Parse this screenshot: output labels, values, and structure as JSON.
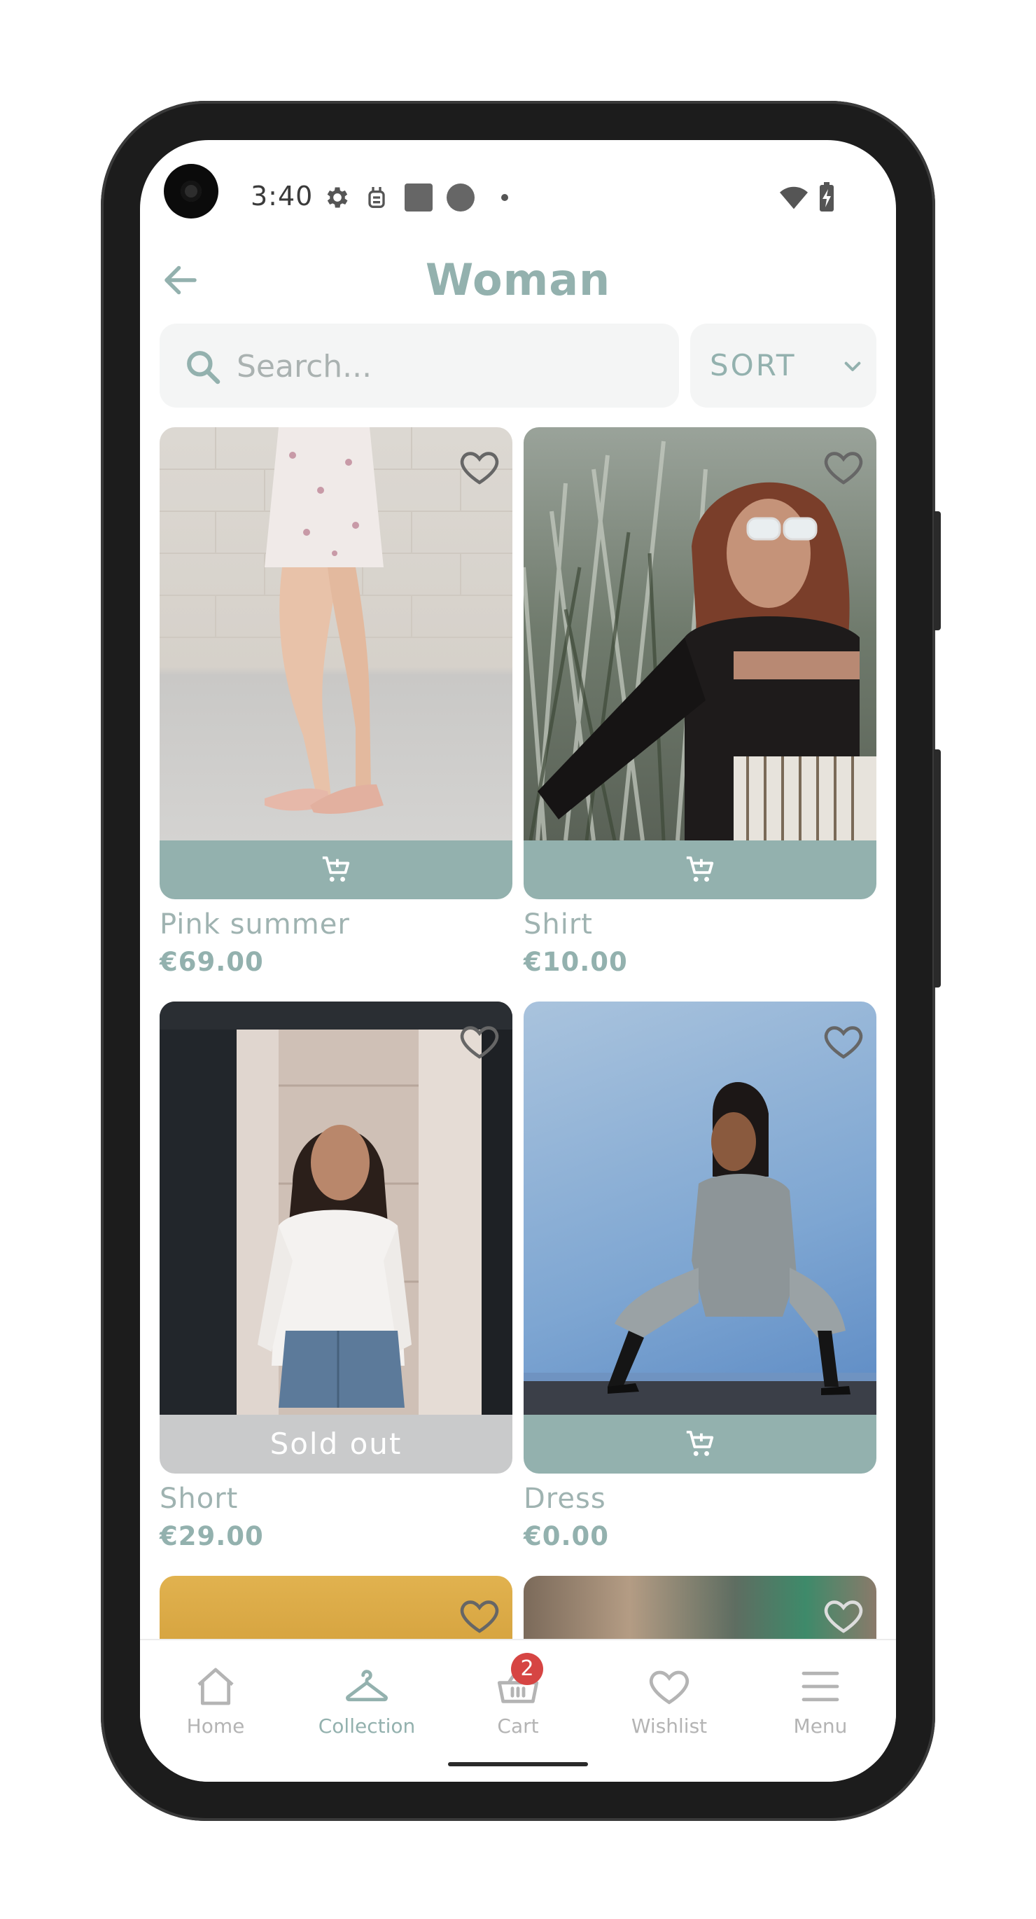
{
  "status_bar": {
    "time": "3:40"
  },
  "header": {
    "title": "Woman"
  },
  "search": {
    "placeholder": "Search..."
  },
  "sort": {
    "label": "SORT"
  },
  "products": [
    {
      "name": "Pink summer",
      "price": "€69.00",
      "status": "add-to-cart"
    },
    {
      "name": "Shirt",
      "price": "€10.00",
      "status": "add-to-cart"
    },
    {
      "name": "Short",
      "price": "€29.00",
      "status": "sold-out",
      "status_label": "Sold out"
    },
    {
      "name": "Dress",
      "price": "€0.00",
      "status": "add-to-cart"
    }
  ],
  "bottom_nav": {
    "items": [
      {
        "label": "Home",
        "icon": "home-icon"
      },
      {
        "label": "Collection",
        "icon": "hanger-icon",
        "active": true
      },
      {
        "label": "Cart",
        "icon": "basket-icon",
        "badge": "2"
      },
      {
        "label": "Wishlist",
        "icon": "heart-icon"
      },
      {
        "label": "Menu",
        "icon": "menu-icon"
      }
    ]
  },
  "colors": {
    "accent": "#93b1ae",
    "sold_out": "#c9cacb",
    "badge": "#d64543",
    "search_bg": "#f4f5f5"
  }
}
